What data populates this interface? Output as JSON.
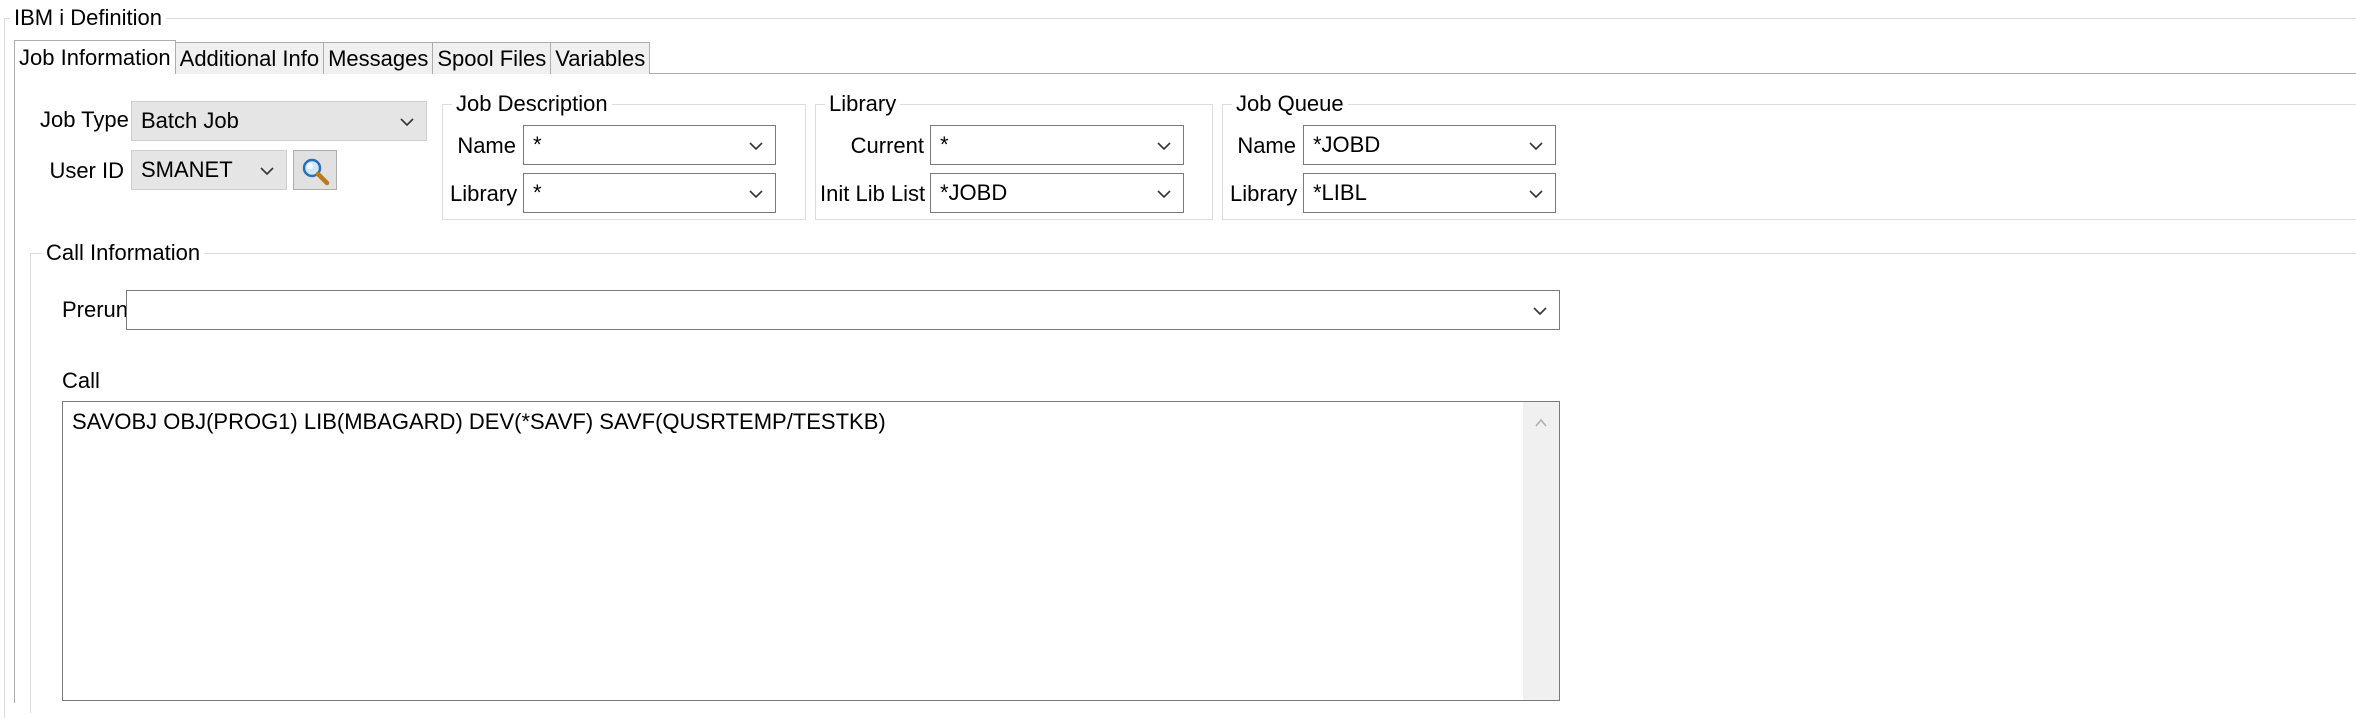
{
  "definition": {
    "title": "IBM i Definition"
  },
  "tabs": [
    {
      "label": "Job Information",
      "active": true
    },
    {
      "label": "Additional Info",
      "active": false
    },
    {
      "label": "Messages",
      "active": false
    },
    {
      "label": "Spool Files",
      "active": false
    },
    {
      "label": "Variables",
      "active": false
    }
  ],
  "job": {
    "type_label": "Job Type",
    "type_value": "Batch Job",
    "user_label": "User ID",
    "user_value": "SMANET",
    "search_icon": "magnifier-icon"
  },
  "job_description": {
    "title": "Job Description",
    "name_label": "Name",
    "name_value": "*",
    "library_label": "Library",
    "library_value": "*"
  },
  "library": {
    "title": "Library",
    "current_label": "Current",
    "current_value": "*",
    "init_label": "Init Lib List",
    "init_value": "*JOBD"
  },
  "job_queue": {
    "title": "Job Queue",
    "name_label": "Name",
    "name_value": "*JOBD",
    "library_label": "Library",
    "library_value": "*LIBL"
  },
  "call_info": {
    "title": "Call Information",
    "prerun_label": "Prerun",
    "prerun_value": "",
    "call_label": "Call",
    "call_value": "SAVOBJ OBJ(PROG1) LIB(MBAGARD) DEV(*SAVF) SAVF(QUSRTEMP/TESTKB)"
  },
  "colors": {
    "border": "#7a7a7a",
    "group_border": "#dcdcdc",
    "readonly_bg": "#e5e5e5",
    "tab_bg": "#f0f0f0"
  }
}
